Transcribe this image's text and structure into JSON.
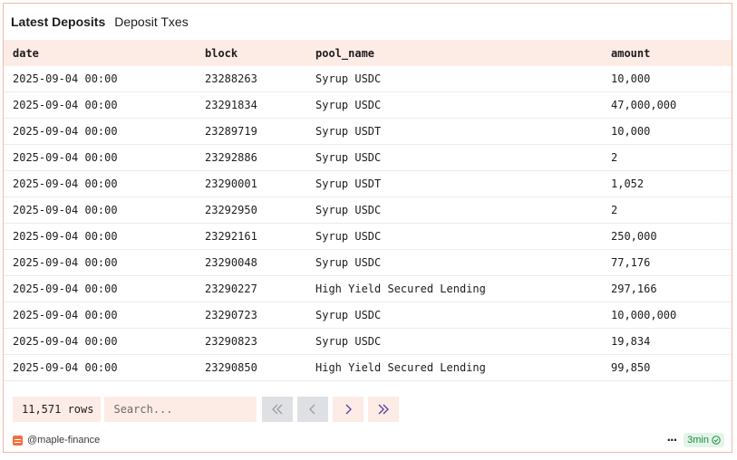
{
  "header": {
    "title": "Latest Deposits",
    "subtitle": "Deposit Txes"
  },
  "table": {
    "columns": [
      "date",
      "block",
      "pool_name",
      "amount"
    ],
    "rows": [
      [
        "2025-09-04 00:00",
        "23288263",
        "Syrup USDC",
        "10,000"
      ],
      [
        "2025-09-04 00:00",
        "23291834",
        "Syrup USDC",
        "47,000,000"
      ],
      [
        "2025-09-04 00:00",
        "23289719",
        "Syrup USDT",
        "10,000"
      ],
      [
        "2025-09-04 00:00",
        "23292886",
        "Syrup USDC",
        "2"
      ],
      [
        "2025-09-04 00:00",
        "23290001",
        "Syrup USDT",
        "1,052"
      ],
      [
        "2025-09-04 00:00",
        "23292950",
        "Syrup USDC",
        "2"
      ],
      [
        "2025-09-04 00:00",
        "23292161",
        "Syrup USDC",
        "250,000"
      ],
      [
        "2025-09-04 00:00",
        "23290048",
        "Syrup USDC",
        "77,176"
      ],
      [
        "2025-09-04 00:00",
        "23290227",
        "High Yield Secured Lending",
        "297,166"
      ],
      [
        "2025-09-04 00:00",
        "23290723",
        "Syrup USDC",
        "10,000,000"
      ],
      [
        "2025-09-04 00:00",
        "23290823",
        "Syrup USDC",
        "19,834"
      ],
      [
        "2025-09-04 00:00",
        "23290850",
        "High Yield Secured Lending",
        "99,850"
      ]
    ]
  },
  "controls": {
    "row_count": "11,571 rows",
    "search_placeholder": "Search...",
    "pagination": {
      "first_icon": "double-chevron-left-icon",
      "prev_icon": "chevron-left-icon",
      "next_icon": "chevron-right-icon",
      "last_icon": "double-chevron-right-icon"
    }
  },
  "footer": {
    "author": "@maple-finance",
    "more_label": "···",
    "refresh_time": "3min",
    "status_icon": "check-circle-icon"
  },
  "colors": {
    "accent_bg": "#fdebe5",
    "border": "#f0b8a8",
    "disabled_btn": "#dfe0e3",
    "badge_bg": "#e3f5e8",
    "badge_text": "#1f8a45",
    "brand": "#f2703f"
  }
}
